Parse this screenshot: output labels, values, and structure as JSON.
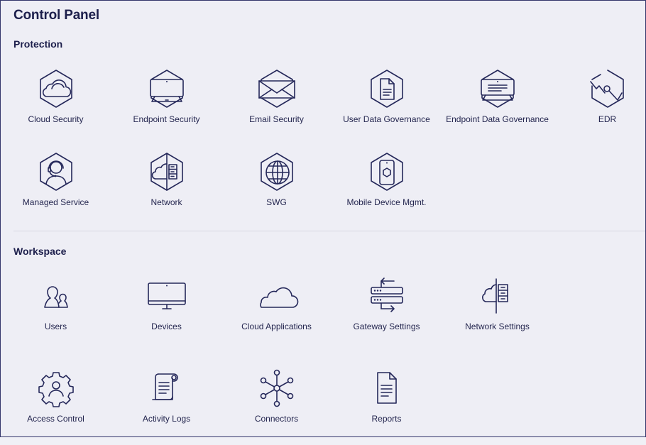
{
  "title": "Control Panel",
  "sections": [
    {
      "title": "Protection",
      "items": [
        {
          "label": "Cloud Security",
          "icon": "cloud-security-icon"
        },
        {
          "label": "Endpoint Security",
          "icon": "endpoint-security-icon"
        },
        {
          "label": "Email Security",
          "icon": "email-security-icon"
        },
        {
          "label": "User Data Governance",
          "icon": "user-data-governance-icon"
        },
        {
          "label": "Endpoint Data Governance",
          "icon": "endpoint-data-governance-icon"
        },
        {
          "label": "EDR",
          "icon": "edr-icon"
        },
        {
          "label": "Managed Service",
          "icon": "managed-service-icon"
        },
        {
          "label": "Network",
          "icon": "network-icon"
        },
        {
          "label": "SWG",
          "icon": "swg-icon"
        },
        {
          "label": "Mobile Device Mgmt.",
          "icon": "mobile-device-icon"
        }
      ]
    },
    {
      "title": "Workspace",
      "items": [
        {
          "label": "Users",
          "icon": "users-icon"
        },
        {
          "label": "Devices",
          "icon": "devices-icon"
        },
        {
          "label": "Cloud Applications",
          "icon": "cloud-icon"
        },
        {
          "label": "Gateway Settings",
          "icon": "gateway-icon"
        },
        {
          "label": "Network Settings",
          "icon": "network-settings-icon"
        },
        {
          "label": "Access Control",
          "icon": "access-control-icon"
        },
        {
          "label": "Activity Logs",
          "icon": "activity-logs-icon"
        },
        {
          "label": "Connectors",
          "icon": "connectors-icon"
        },
        {
          "label": "Reports",
          "icon": "reports-icon"
        }
      ]
    }
  ],
  "colors": {
    "accent": "#25285a",
    "background": "#eeeef5",
    "divider": "#d7d7e2"
  }
}
